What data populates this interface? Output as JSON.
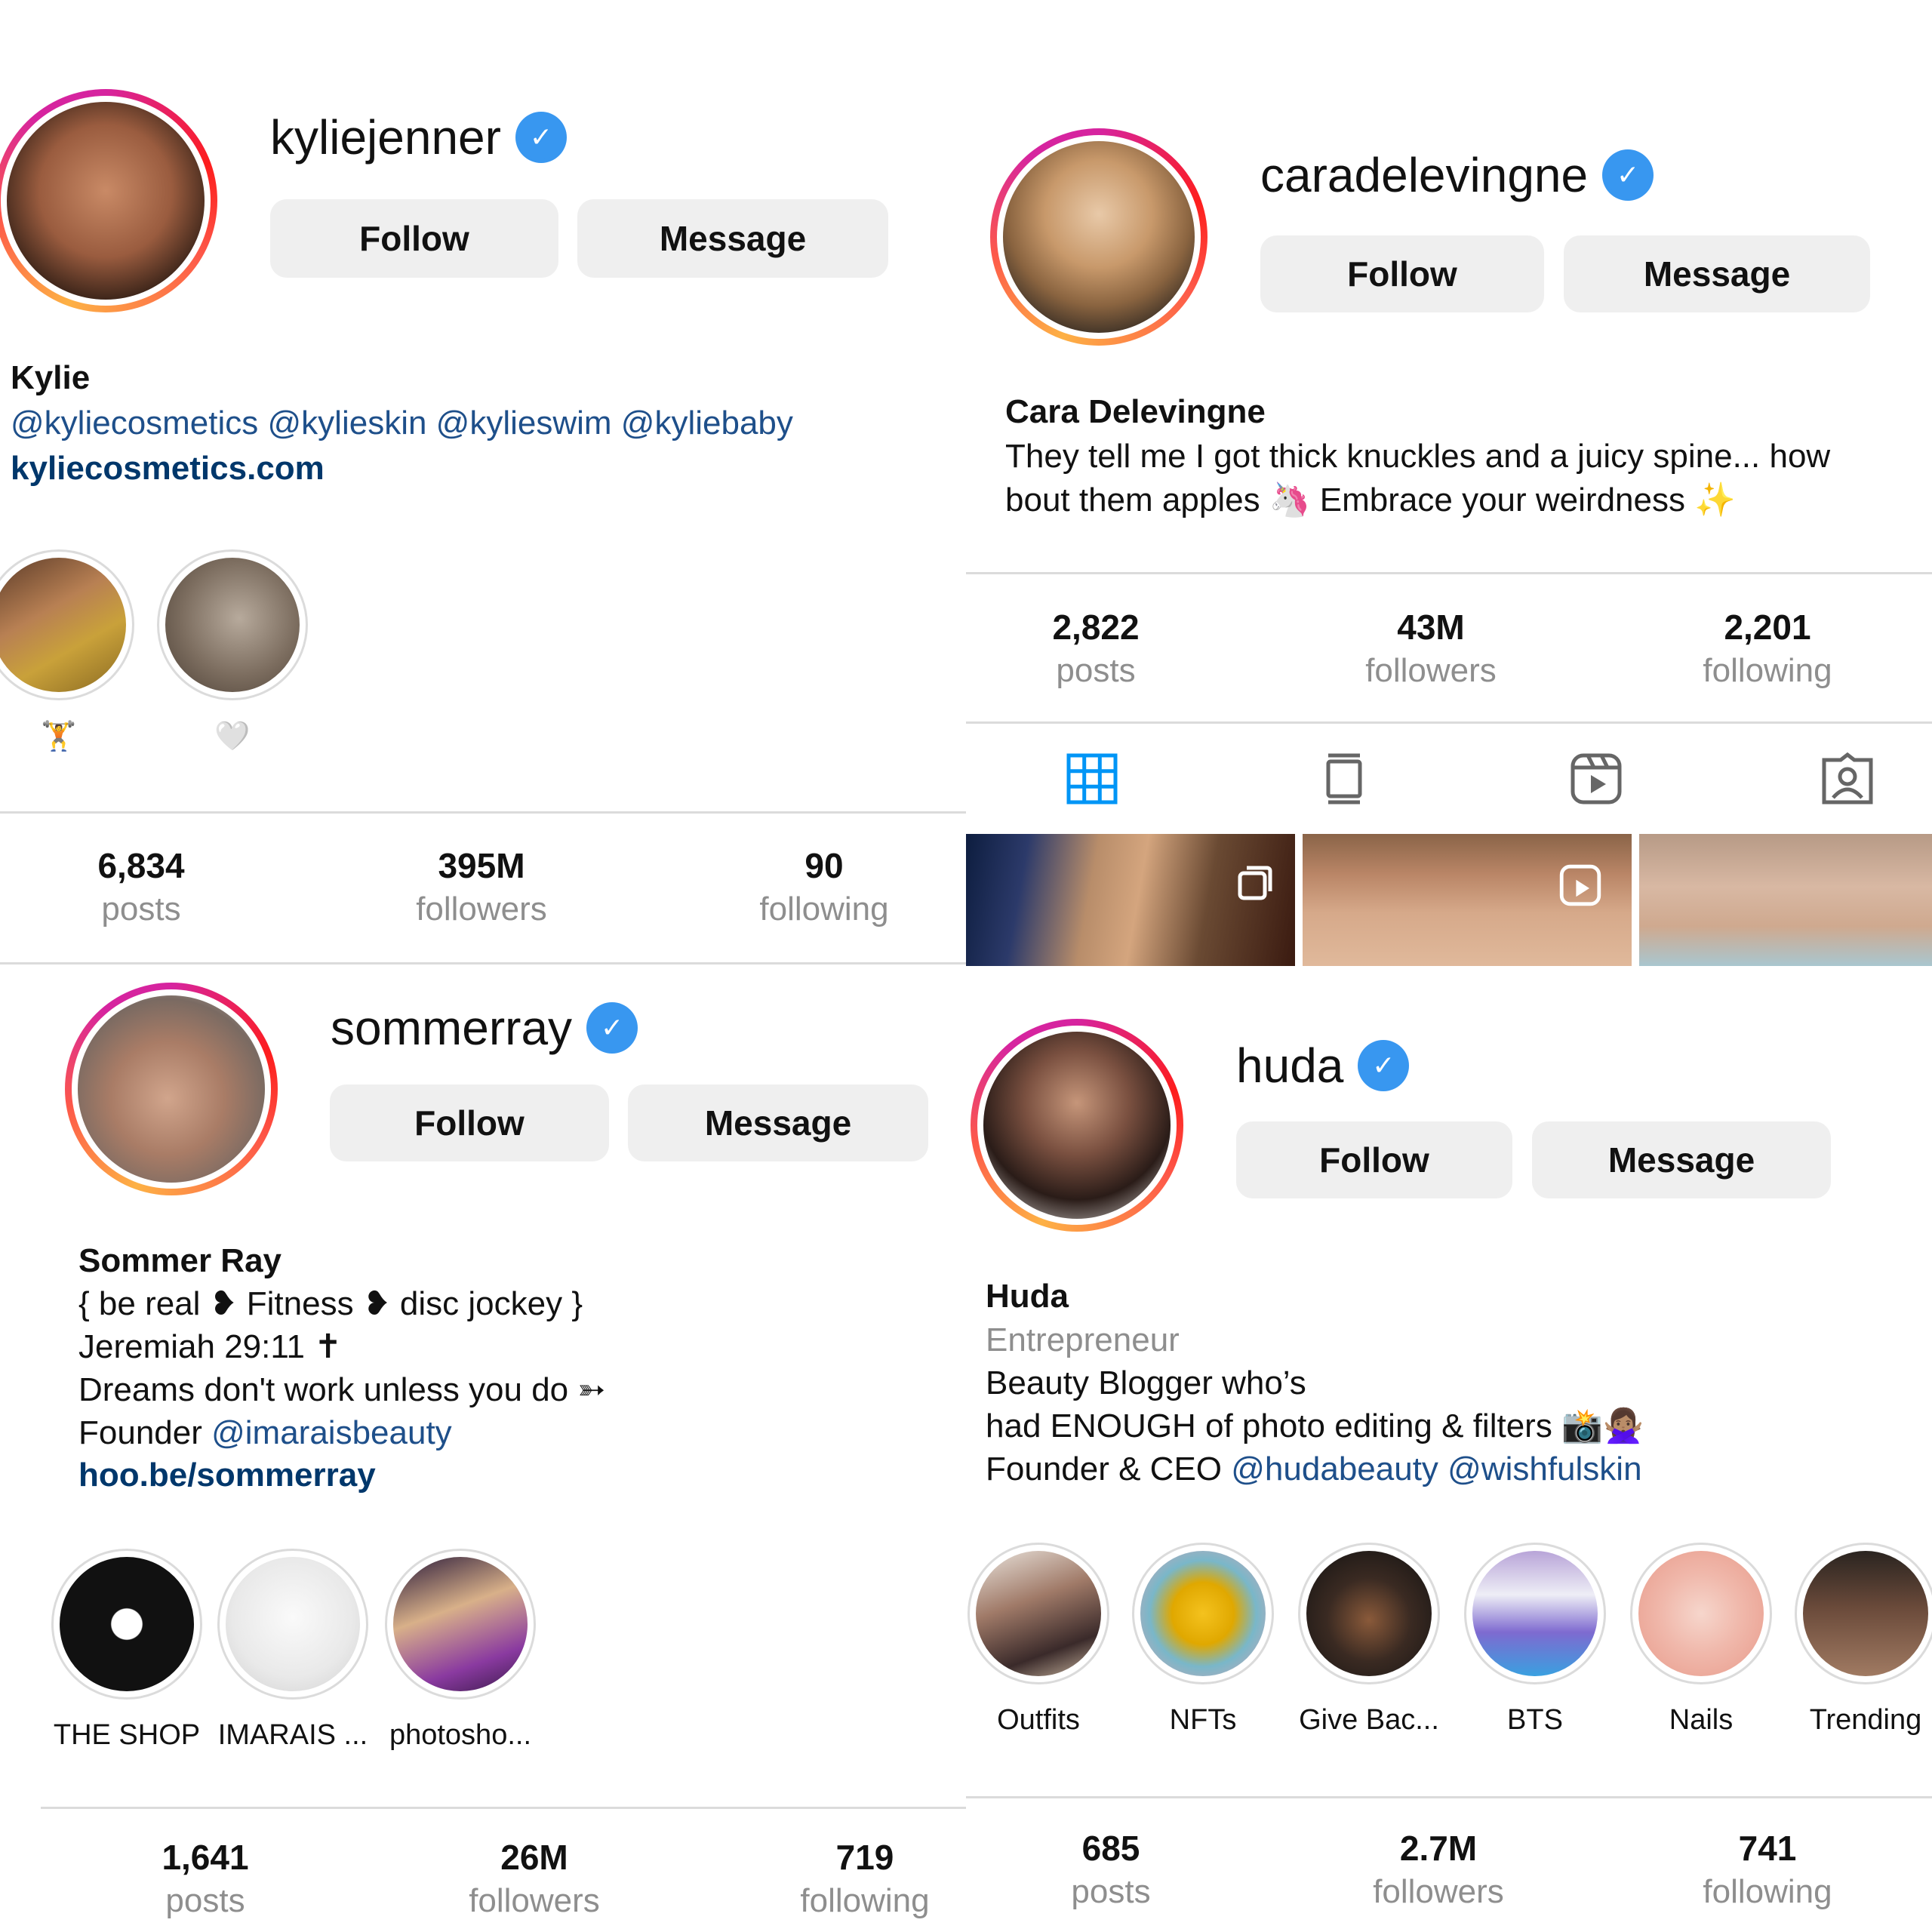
{
  "profiles": {
    "kylie": {
      "username": "kyliejenner",
      "name": "Kylie",
      "bio_mentions": "@kyliecosmetics @kylieskin @kylieswim @kyliebaby",
      "website": "kyliecosmetics.com",
      "follow_label": "Follow",
      "message_label": "Message",
      "highlights": [
        {
          "label": "🏋️"
        },
        {
          "label": "🤍"
        }
      ],
      "stats": {
        "posts": "6,834",
        "posts_label": "posts",
        "followers": "395M",
        "followers_label": "followers",
        "following": "90",
        "following_label": "following"
      }
    },
    "cara": {
      "username": "caradelevingne",
      "name": "Cara Delevingne",
      "bio_line1": "They tell me I got thick knuckles and a juicy spine... how",
      "bio_line2": "bout them apples 🦄 Embrace your weirdness ✨",
      "follow_label": "Follow",
      "message_label": "Message",
      "stats": {
        "posts": "2,822",
        "posts_label": "posts",
        "followers": "43M",
        "followers_label": "followers",
        "following": "2,201",
        "following_label": "following"
      },
      "tabs": [
        "grid-icon",
        "igtv-icon",
        "reels-icon",
        "tagged-icon"
      ]
    },
    "sommer": {
      "username": "sommerray",
      "name": "Sommer Ray",
      "bio_line1": "{ be real ❥ Fitness ❥ disc jockey }",
      "bio_line2": "Jeremiah 29:11 ✝",
      "bio_line3": "Dreams don't work unless you do ➳",
      "bio_line4_prefix": "Founder ",
      "bio_line4_mention": "@imaraisbeauty",
      "website": "hoo.be/sommerray",
      "follow_label": "Follow",
      "message_label": "Message",
      "highlights": [
        {
          "label": "THE SHOP"
        },
        {
          "label": "IMARAIS ..."
        },
        {
          "label": "photosho..."
        }
      ],
      "stats": {
        "posts": "1,641",
        "posts_label": "posts",
        "followers": "26M",
        "followers_label": "followers",
        "following": "719",
        "following_label": "following"
      }
    },
    "huda": {
      "username": "huda",
      "name": "Huda",
      "category": "Entrepreneur",
      "bio_line1": "Beauty Blogger who’s",
      "bio_line2": "had ENOUGH of photo editing & filters 📸🙅🏽‍♀️",
      "bio_line3_prefix": "Founder & CEO ",
      "bio_line3_mentions": "@hudabeauty @wishfulskin",
      "follow_label": "Follow",
      "message_label": "Message",
      "highlights": [
        {
          "label": "Outfits"
        },
        {
          "label": "NFTs"
        },
        {
          "label": "Give Bac..."
        },
        {
          "label": "BTS"
        },
        {
          "label": "Nails"
        },
        {
          "label": "Trending"
        }
      ],
      "stats": {
        "posts": "685",
        "posts_label": "posts",
        "followers": "2.7M",
        "followers_label": "followers",
        "following": "741",
        "following_label": "following"
      }
    }
  },
  "colors": {
    "verified": "#3897f0",
    "button_bg": "#efefef",
    "link": "#00376b",
    "tab_active": "#0095f6"
  }
}
